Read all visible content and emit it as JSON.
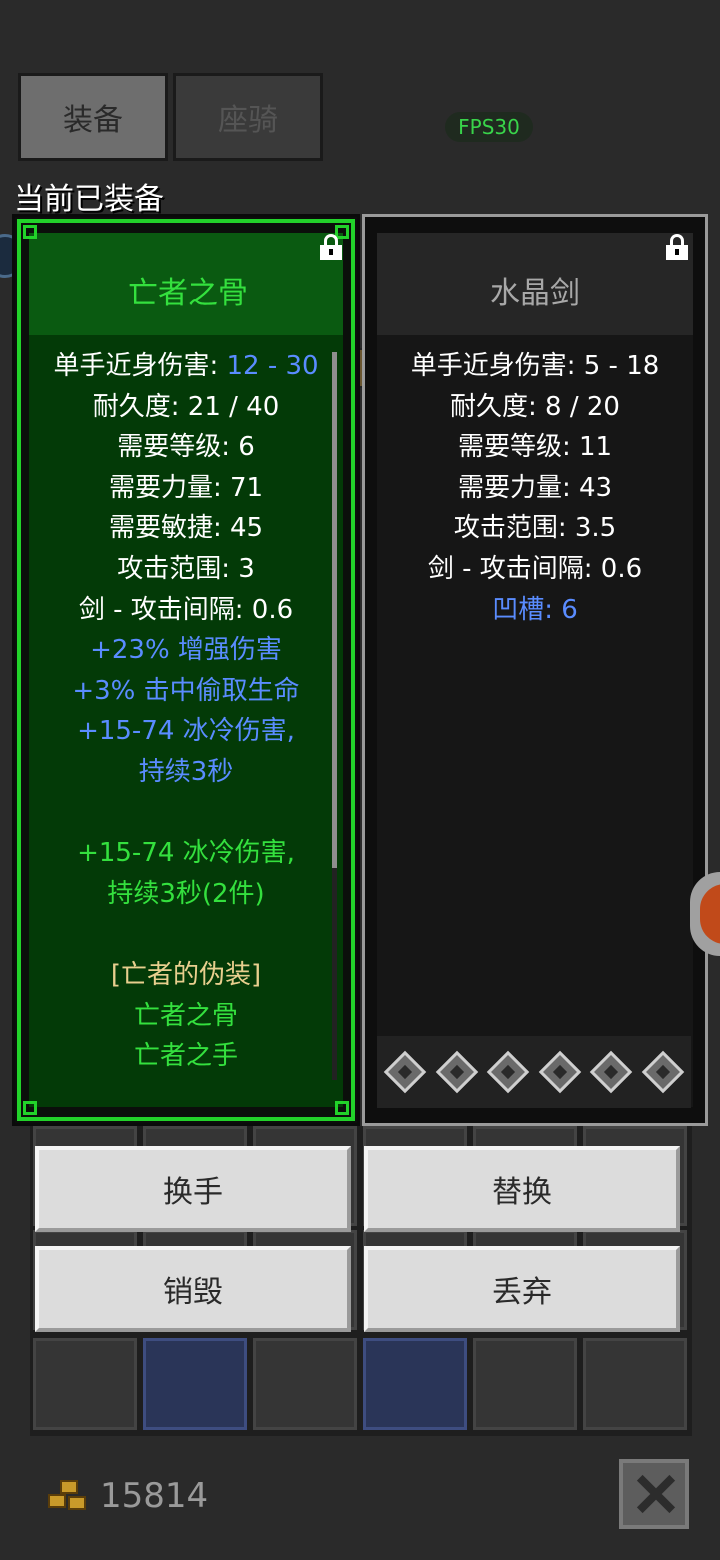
{
  "tabs": [
    {
      "label": "装备",
      "active": true
    },
    {
      "label": "座骑",
      "active": false
    }
  ],
  "fps": "FPS30",
  "current_equipped_label": "当前已装备",
  "left_item": {
    "name": "亡者之骨",
    "name_color": "#34e03e",
    "locked": true,
    "lines": [
      {
        "parts": [
          {
            "text": "单手近身伤害: ",
            "color": "white"
          },
          {
            "text": "12 - 30",
            "color": "blue"
          }
        ]
      },
      {
        "parts": [
          {
            "text": "耐久度: 21 / 40",
            "color": "white"
          }
        ]
      },
      {
        "parts": [
          {
            "text": "需要等级: 6",
            "color": "white"
          }
        ]
      },
      {
        "parts": [
          {
            "text": "需要力量: 71",
            "color": "white"
          }
        ]
      },
      {
        "parts": [
          {
            "text": "需要敏捷: 45",
            "color": "white"
          }
        ]
      },
      {
        "parts": [
          {
            "text": "攻击范围: 3",
            "color": "white"
          }
        ]
      },
      {
        "parts": [
          {
            "text": "剑 - 攻击间隔: 0.6",
            "color": "white"
          }
        ]
      },
      {
        "parts": [
          {
            "text": "+23% 增强伤害",
            "color": "blue"
          }
        ]
      },
      {
        "parts": [
          {
            "text": "+3% 击中偷取生命",
            "color": "blue"
          }
        ]
      },
      {
        "parts": [
          {
            "text": "+15-74 冰冷伤害,",
            "color": "blue"
          }
        ]
      },
      {
        "parts": [
          {
            "text": "持续3秒",
            "color": "blue"
          }
        ]
      },
      {
        "parts": [
          {
            "text": "",
            "color": "white"
          }
        ]
      },
      {
        "parts": [
          {
            "text": "+15-74 冰冷伤害,",
            "color": "green"
          }
        ]
      },
      {
        "parts": [
          {
            "text": "持续3秒(2件)",
            "color": "green"
          }
        ]
      },
      {
        "parts": [
          {
            "text": "",
            "color": "white"
          }
        ]
      },
      {
        "parts": [
          {
            "text": "[亡者的伪装]",
            "color": "tan"
          }
        ]
      },
      {
        "parts": [
          {
            "text": "亡者之骨",
            "color": "green"
          }
        ]
      },
      {
        "parts": [
          {
            "text": "亡者之手",
            "color": "green"
          }
        ]
      }
    ]
  },
  "right_item": {
    "name": "水晶剑",
    "name_color": "#a8a8a8",
    "locked": true,
    "lines": [
      {
        "parts": [
          {
            "text": "单手近身伤害: 5 - 18",
            "color": "white"
          }
        ]
      },
      {
        "parts": [
          {
            "text": "耐久度: 8 / 20",
            "color": "white"
          }
        ]
      },
      {
        "parts": [
          {
            "text": "需要等级: 11",
            "color": "white"
          }
        ]
      },
      {
        "parts": [
          {
            "text": "需要力量: 43",
            "color": "white"
          }
        ]
      },
      {
        "parts": [
          {
            "text": "攻击范围: 3.5",
            "color": "white"
          }
        ]
      },
      {
        "parts": [
          {
            "text": "剑 - 攻击间隔: 0.6",
            "color": "white"
          }
        ]
      },
      {
        "parts": [
          {
            "text": "凹槽: 6",
            "color": "blue"
          }
        ]
      }
    ],
    "socket_count": 6
  },
  "actions": {
    "swap_hand": "换手",
    "replace": "替换",
    "destroy": "销毁",
    "drop": "丢弃"
  },
  "gold": "15814",
  "icons": {
    "lock": "lock-icon",
    "close": "close-icon",
    "gold": "gold-coins-icon",
    "socket": "socket-icon"
  },
  "colors": {
    "set_green": "#34e03e",
    "magic_blue": "#5a8cff",
    "set_name_tan": "#e8cf8e"
  }
}
